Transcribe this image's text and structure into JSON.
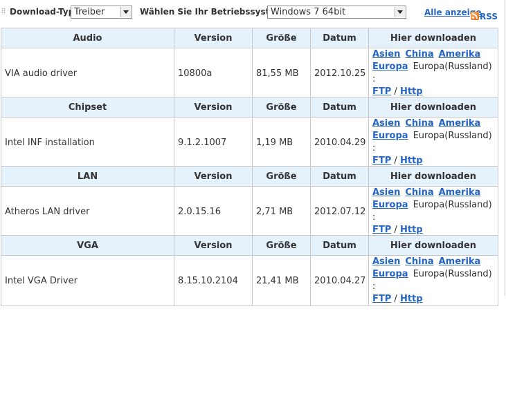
{
  "filters": {
    "download_type_label": "Download-Typ:",
    "download_type_value": "Treiber",
    "os_label": "Wählen Sie Ihr Betriebssystem:",
    "os_value": "Windows 7 64bit",
    "show_all_link": "Alle anzeige",
    "rss_label": "RSS"
  },
  "columns": {
    "version": "Version",
    "size": "Größe",
    "date": "Datum",
    "download": "Hier downloaden"
  },
  "download_links": {
    "asia": "Asien",
    "china": "China",
    "america": "Amerika",
    "europe": "Europa",
    "europe_russia": "Europa(Russland) :",
    "ftp": "FTP",
    "separator": "/",
    "http": "Http"
  },
  "sections": [
    {
      "category": "Audio",
      "name": "VIA audio driver",
      "version": "10800a",
      "size": "81,55 MB",
      "date": "2012.10.25"
    },
    {
      "category": "Chipset",
      "name": "Intel INF installation",
      "version": "9.1.2.1007",
      "size": "1,19 MB",
      "date": "2010.04.29"
    },
    {
      "category": "LAN",
      "name": "Atheros LAN driver",
      "version": "2.0.15.16",
      "size": "2,71 MB",
      "date": "2012.07.12"
    },
    {
      "category": "VGA",
      "name": "Intel VGA Driver",
      "version": "8.15.10.2104",
      "size": "21,41 MB",
      "date": "2010.04.27"
    }
  ],
  "colors": {
    "header_bg": "#e5f1fb",
    "link": "#2766c4",
    "border": "#c8c8c8",
    "text": "#333333"
  },
  "icons": [
    "grip-icon",
    "dropdown-arrow-icon",
    "rss-icon"
  ]
}
